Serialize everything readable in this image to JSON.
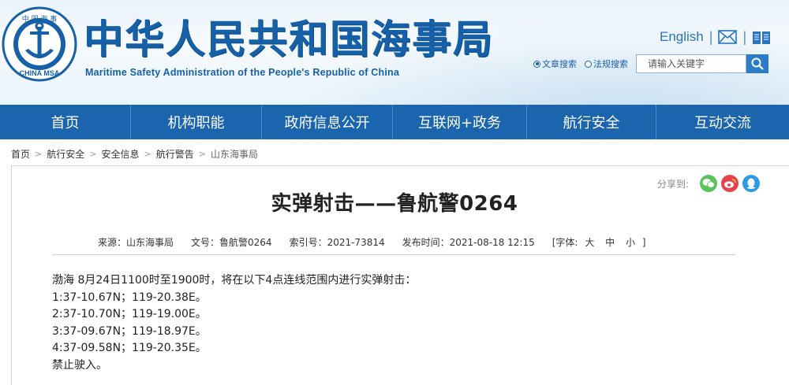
{
  "header": {
    "logo_top_text": "中 国 海 事",
    "logo_bottom_text": "CHINA MSA",
    "title": "中华人民共和国海事局",
    "subtitle": "Maritime Safety Administration of the People's Republic of China",
    "english_link": "English",
    "brand_color": "#1660a8"
  },
  "search": {
    "option_article": "文章搜索",
    "option_law": "法规搜索",
    "placeholder": "请输入关键字",
    "selected": "文章搜索"
  },
  "nav": {
    "items": [
      {
        "label": "首页"
      },
      {
        "label": "机构职能"
      },
      {
        "label": "政府信息公开"
      },
      {
        "label": "互联网+政务"
      },
      {
        "label": "航行安全"
      },
      {
        "label": "互动交流"
      }
    ],
    "color": "#1a65ae"
  },
  "breadcrumb": [
    "首页",
    "航行安全",
    "安全信息",
    "航行警告",
    "山东海事局"
  ],
  "share": {
    "label": "分享到:",
    "icons": [
      "wechat-icon",
      "weibo-icon",
      "qq-icon"
    ]
  },
  "article": {
    "title": "实弹射击——鲁航警0264",
    "meta": {
      "source": "来源：山东海事局",
      "doc_no": "文号：鲁航警0264",
      "index_no": "索引号：2021-73814",
      "publish_time": "发布时间：2021-08-18 12:15",
      "font_size_label": "[字体:",
      "font_large": "大",
      "font_medium": "中",
      "font_small": "小",
      "font_close": "]"
    },
    "lines": [
      "渤海 8月24日1100时至1900时，将在以下4点连线范围内进行实弹射击：",
      "1:37-10.67N；119-20.38E。",
      "2:37-10.70N；119-19.00E。",
      "3:37-09.67N；119-18.97E。",
      "4:37-09.58N；119-20.35E。",
      "禁止驶入。"
    ]
  }
}
